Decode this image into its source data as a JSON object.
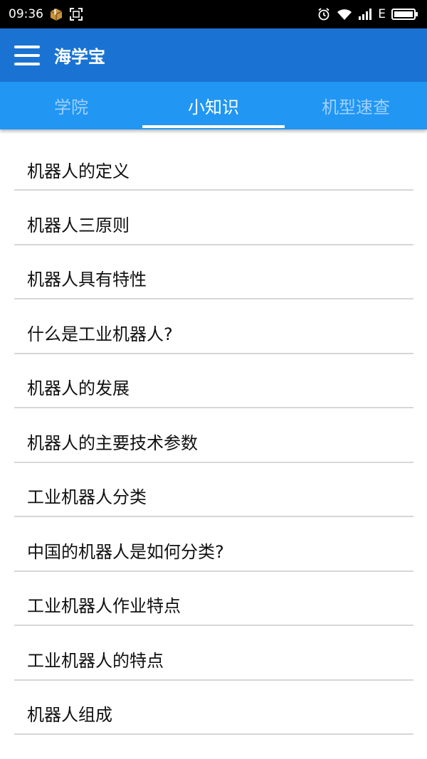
{
  "status_bar": {
    "time": "09:36",
    "network_type": "E",
    "icons": [
      "package-icon",
      "screenshot-icon",
      "alarm-icon",
      "wifi-icon",
      "signal-icon",
      "battery-icon"
    ]
  },
  "app_bar": {
    "title": "海学宝",
    "menu_icon": "hamburger-menu-icon",
    "color": "#1a73d2"
  },
  "tabs": {
    "items": [
      {
        "label": "学院",
        "active": false
      },
      {
        "label": "小知识",
        "active": true
      },
      {
        "label": "机型速查",
        "active": false
      }
    ],
    "color": "#2196f3",
    "inactive_text_color": "#9fd0ff"
  },
  "list": {
    "items": [
      {
        "label": "机器人的定义"
      },
      {
        "label": "机器人三原则"
      },
      {
        "label": "机器人具有特性"
      },
      {
        "label": "什么是工业机器人?"
      },
      {
        "label": "机器人的发展"
      },
      {
        "label": "机器人的主要技术参数"
      },
      {
        "label": "工业机器人分类"
      },
      {
        "label": "中国的机器人是如何分类?"
      },
      {
        "label": "工业机器人作业特点"
      },
      {
        "label": "工业机器人的特点"
      },
      {
        "label": "机器人组成"
      }
    ]
  }
}
